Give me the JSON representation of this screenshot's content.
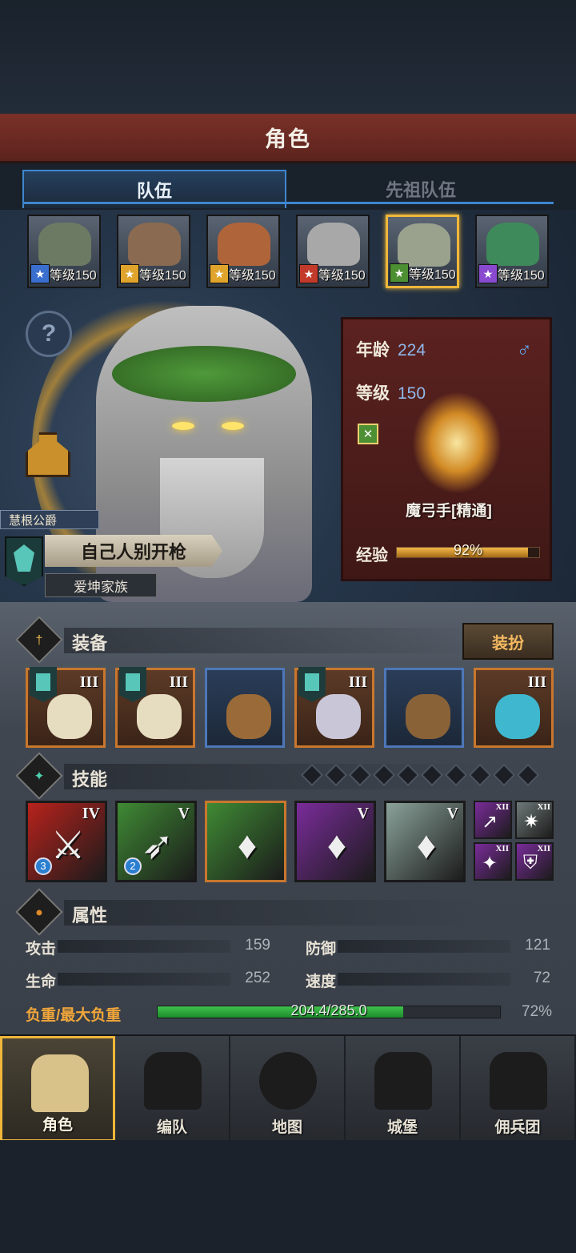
{
  "header": {
    "title": "角色"
  },
  "tabs": [
    {
      "label": "队伍",
      "active": true
    },
    {
      "label": "先祖队伍",
      "active": false
    }
  ],
  "party": [
    {
      "level_text": "等级150",
      "class_color": "#3a6fd0",
      "face_color": "#6c7a64",
      "selected": false
    },
    {
      "level_text": "等级150",
      "class_color": "#e0a42c",
      "face_color": "#8a6a50",
      "selected": false
    },
    {
      "level_text": "等级150",
      "class_color": "#e0a42c",
      "face_color": "#b0643a",
      "selected": false
    },
    {
      "level_text": "等级150",
      "class_color": "#c33a2a",
      "face_color": "#a8a8a8",
      "selected": false
    },
    {
      "level_text": "等级150",
      "class_color": "#4d8f33",
      "face_color": "#9aa28e",
      "selected": true
    },
    {
      "level_text": "等级150",
      "class_color": "#8a4ad0",
      "face_color": "#3e8a5a",
      "selected": false
    }
  ],
  "hero": {
    "title": "慧根公爵",
    "name": "自己人别开枪",
    "family": "爱坤家族"
  },
  "info": {
    "age_label": "年龄",
    "age": "224",
    "level_label": "等级",
    "level": "150",
    "gender_icon": "♂",
    "class_name": "魔弓手[精通]",
    "exp_label": "经验",
    "exp_text": "92%",
    "exp_fraction": 0.92
  },
  "equipment": {
    "title": "装备",
    "dress_button": "装扮",
    "slots": [
      {
        "tier": "III",
        "rarity": "orange",
        "banner": true,
        "art_color": "#e6dcc0"
      },
      {
        "tier": "III",
        "rarity": "orange",
        "banner": true,
        "art_color": "#e6dcc0"
      },
      {
        "tier": "",
        "rarity": "blue",
        "banner": false,
        "art_color": "#9a6a38"
      },
      {
        "tier": "III",
        "rarity": "orange",
        "banner": true,
        "art_color": "#c9c6d8"
      },
      {
        "tier": "",
        "rarity": "blue",
        "banner": false,
        "art_color": "#8a6238"
      },
      {
        "tier": "III",
        "rarity": "orange",
        "banner": false,
        "art_color": "#3fb8cf"
      }
    ]
  },
  "skills": {
    "title": "技能",
    "diamond_count": 10,
    "items": [
      {
        "tier": "IV",
        "bg": "#b8221c",
        "glyph": "⚔",
        "badge": "3"
      },
      {
        "tier": "V",
        "bg": "#3f8a34",
        "glyph": "➶",
        "badge": "2"
      },
      {
        "tier": "",
        "bg": "#3f8a34",
        "glyph": "♦",
        "badge": ""
      },
      {
        "tier": "V",
        "bg": "#7a2c9a",
        "glyph": "♦",
        "badge": ""
      },
      {
        "tier": "V",
        "bg": "#8aa29a",
        "glyph": "♦",
        "badge": ""
      }
    ],
    "mini": [
      {
        "tier": "XII",
        "bg": "#7a2c9a",
        "glyph": "↗"
      },
      {
        "tier": "XII",
        "bg": "#6e7a78",
        "glyph": "✷"
      },
      {
        "tier": "XII",
        "bg": "#7a2c9a",
        "glyph": "✦"
      },
      {
        "tier": "XII",
        "bg": "#7a2c9a",
        "glyph": "⛨"
      }
    ]
  },
  "attributes": {
    "title": "属性",
    "stats": [
      {
        "label": "攻击",
        "value": "159"
      },
      {
        "label": "防御",
        "value": "121"
      },
      {
        "label": "生命",
        "value": "252"
      },
      {
        "label": "速度",
        "value": "72"
      }
    ],
    "load_label": "负重/最大负重",
    "load_text": "204.4/285.0",
    "load_fraction": 0.717,
    "load_pct": "72%"
  },
  "nav": [
    {
      "label": "角色",
      "active": true,
      "icon": "knight-icon"
    },
    {
      "label": "编队",
      "active": false,
      "icon": "helmet-icon"
    },
    {
      "label": "地图",
      "active": false,
      "icon": "compass-map-icon"
    },
    {
      "label": "城堡",
      "active": false,
      "icon": "castle-icon"
    },
    {
      "label": "佣兵团",
      "active": false,
      "icon": "mercenary-icon"
    }
  ],
  "colors": {
    "accent_gold": "#f0b73a",
    "tab_blue": "#3e86cf",
    "banner_red": "#7a3128",
    "load_green": "#2fae3d"
  }
}
